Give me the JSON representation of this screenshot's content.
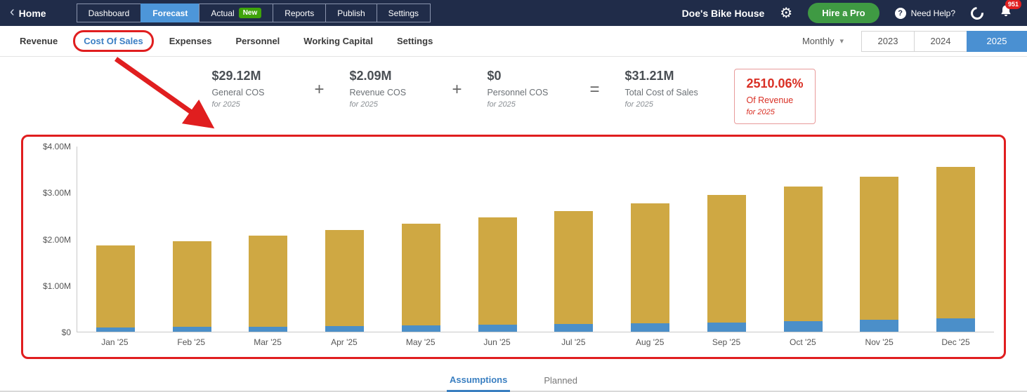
{
  "topbar": {
    "home": "Home",
    "tabs": [
      {
        "label": "Dashboard"
      },
      {
        "label": "Forecast"
      },
      {
        "label": "Actual",
        "badge": "New"
      },
      {
        "label": "Reports"
      },
      {
        "label": "Publish"
      },
      {
        "label": "Settings"
      }
    ],
    "active_tab": "Forecast",
    "company": "Doe's Bike House",
    "hire_pro": "Hire a Pro",
    "need_help": "Need Help?",
    "bell_badge": "951"
  },
  "subnav": {
    "items": [
      "Revenue",
      "Cost Of Sales",
      "Expenses",
      "Personnel",
      "Working Capital",
      "Settings"
    ],
    "active": "Cost Of Sales",
    "period": "Monthly",
    "years": [
      "2023",
      "2024",
      "2025"
    ],
    "active_year": "2025"
  },
  "summary": {
    "items": [
      {
        "value": "$29.12M",
        "label": "General COS",
        "sub": "for 2025"
      },
      {
        "value": "$2.09M",
        "label": "Revenue COS",
        "sub": "for 2025"
      },
      {
        "value": "$0",
        "label": "Personnel COS",
        "sub": "for 2025"
      },
      {
        "value": "$31.21M",
        "label": "Total Cost of Sales",
        "sub": "for 2025"
      }
    ],
    "operators": [
      "+",
      "+",
      "="
    ],
    "ratio": {
      "value": "2510.06%",
      "label": "Of Revenue",
      "sub": "for 2025"
    }
  },
  "chart_data": {
    "type": "bar",
    "stacked": true,
    "categories": [
      "Jan '25",
      "Feb '25",
      "Mar '25",
      "Apr '25",
      "May '25",
      "Jun '25",
      "Jul '25",
      "Aug '25",
      "Sep '25",
      "Oct '25",
      "Nov '25",
      "Dec '25"
    ],
    "series": [
      {
        "name": "Revenue COS",
        "color": "#4b8fc9",
        "values": [
          0.09,
          0.1,
          0.11,
          0.12,
          0.14,
          0.15,
          0.17,
          0.18,
          0.2,
          0.22,
          0.25,
          0.28
        ]
      },
      {
        "name": "General COS",
        "color": "#cfa843",
        "values": [
          1.77,
          1.85,
          1.96,
          2.07,
          2.18,
          2.31,
          2.43,
          2.58,
          2.74,
          2.91,
          3.08,
          3.27
        ]
      }
    ],
    "y_ticks": [
      "$0",
      "$1.00M",
      "$2.00M",
      "$3.00M",
      "$4.00M"
    ],
    "ylim": [
      0,
      4
    ],
    "ylabel": "",
    "xlabel": "",
    "grid": false,
    "legend": false
  },
  "footer_tabs": {
    "assumptions": "Assumptions",
    "planned": "Planned"
  }
}
